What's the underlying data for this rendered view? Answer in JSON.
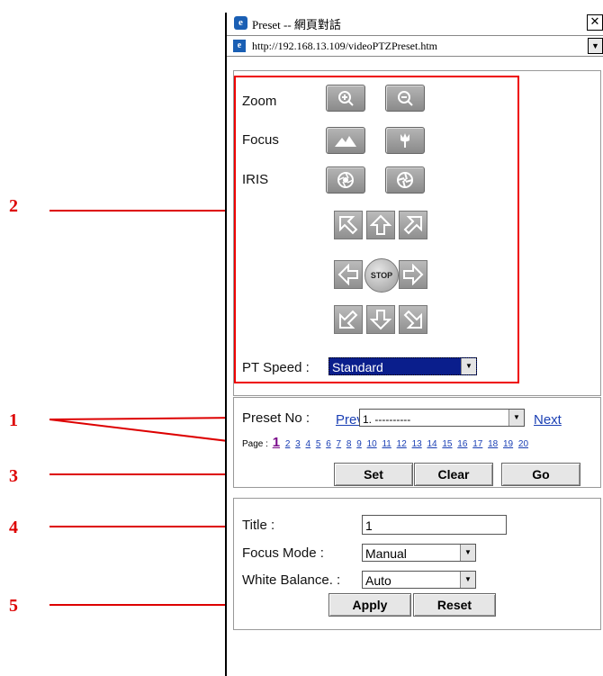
{
  "window": {
    "title": "Preset -- 網頁對話",
    "close": "✕",
    "url": "http://192.168.13.109/videoPTZPreset.htm"
  },
  "ptz": {
    "zoom_label": "Zoom",
    "focus_label": "Focus",
    "iris_label": "IRIS",
    "stop_label": "STOP",
    "pt_speed_label": "PT Speed :",
    "pt_speed_value": "Standard"
  },
  "preset": {
    "label": "Preset No :",
    "prev": "Prev",
    "value": "1. ----------",
    "next": "Next",
    "page_label": "Page :",
    "pages": [
      "1",
      "2",
      "3",
      "4",
      "5",
      "6",
      "7",
      "8",
      "9",
      "10",
      "11",
      "12",
      "13",
      "14",
      "15",
      "16",
      "17",
      "18",
      "19",
      "20"
    ],
    "set": "Set",
    "clear": "Clear",
    "go": "Go"
  },
  "settings": {
    "title_label": "Title :",
    "title_value": "1",
    "focus_mode_label": "Focus Mode :",
    "focus_mode_value": "Manual",
    "wb_label": "White Balance. :",
    "wb_value": "Auto",
    "apply": "Apply",
    "reset": "Reset"
  },
  "callouts": [
    "2",
    "1",
    "3",
    "4",
    "5"
  ],
  "colors": {
    "callout": "#dd0000",
    "link": "#1a3fb4",
    "selected": "#0a1e8c"
  }
}
